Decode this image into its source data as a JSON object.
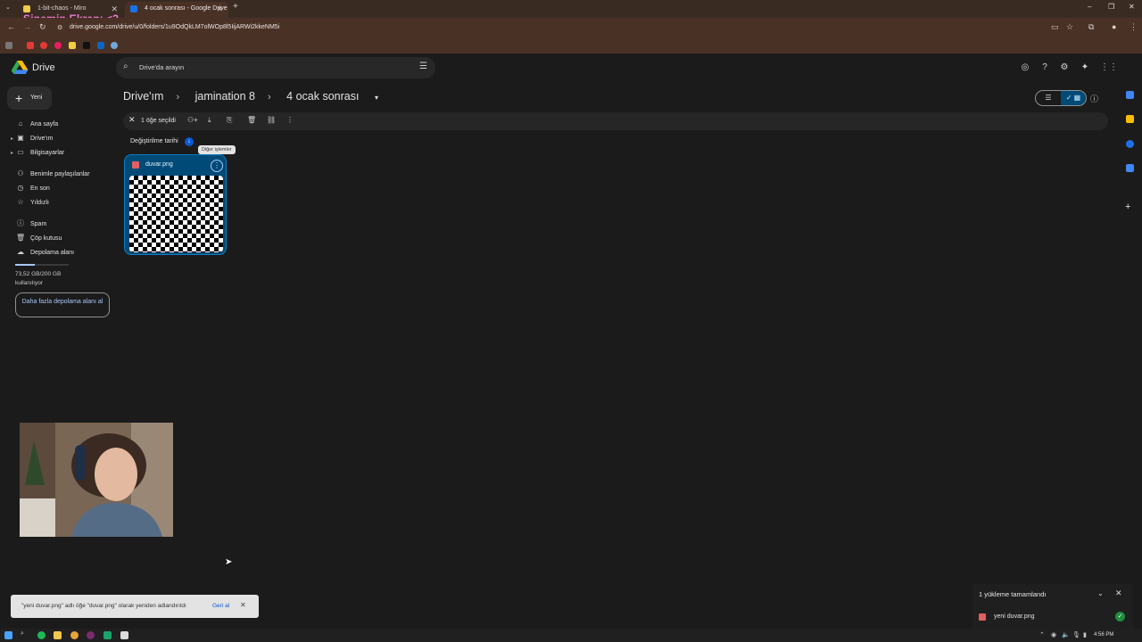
{
  "overlay": {
    "stream_title": "Sinemin Ekranı <3"
  },
  "browser": {
    "tabs": [
      {
        "title": "1-bit-chaos - Miro"
      },
      {
        "title": "4 ocak sonrası - Google Drive"
      }
    ],
    "new_tab": "+",
    "url": "drive.google.com/drive/u/0/folders/1u9OdQkLM7olWOp8l5IijARWi2kkeNM5i",
    "window_controls": {
      "minimize": "–",
      "restore": "❐",
      "close": "✕"
    }
  },
  "drive": {
    "brand": "Drive",
    "new_button": "Yeni",
    "search_placeholder": "Drive'da arayın",
    "nav": [
      {
        "label": "Ana sayfa",
        "icon": "home-icon"
      },
      {
        "label": "Drive'ım",
        "icon": "drive-icon"
      },
      {
        "label": "Bilgisayarlar",
        "icon": "computer-icon"
      },
      {
        "label": "Benimle paylaşılanlar",
        "icon": "shared-icon"
      },
      {
        "label": "En son",
        "icon": "clock-icon"
      },
      {
        "label": "Yıldızlı",
        "icon": "star-icon"
      },
      {
        "label": "Spam",
        "icon": "spam-icon"
      },
      {
        "label": "Çöp kutusu",
        "icon": "trash-icon"
      },
      {
        "label": "Depolama alanı",
        "icon": "cloud-icon"
      }
    ],
    "storage": {
      "text": "73,52 GB/200 GB kullanılıyor",
      "used_fraction": 0.37,
      "buy_button": "Daha fazla depolama alanı al"
    },
    "breadcrumbs": [
      "Drive'ım",
      "jamination 8",
      "4 ocak sonrası"
    ],
    "selection_bar": {
      "count_label": "1 öğe seçildi"
    },
    "sort_label": "Değiştirilme tarihi",
    "tooltip": "Diğer işlemler",
    "file": {
      "name": "duvar.png"
    }
  },
  "snackbar": {
    "message": "\"yeni duvar.png\" adlı öğe \"duvar.png\" olarak yeniden adlandırıldı",
    "undo": "Geri al"
  },
  "upload_panel": {
    "title": "1 yükleme tamamlandı",
    "item": "yeni duvar.png"
  },
  "taskbar": {
    "clock": "4:56 PM"
  },
  "colors": {
    "accent": "#0b57d0",
    "selected_card": "#004a77",
    "chrome": "#4a3126"
  }
}
